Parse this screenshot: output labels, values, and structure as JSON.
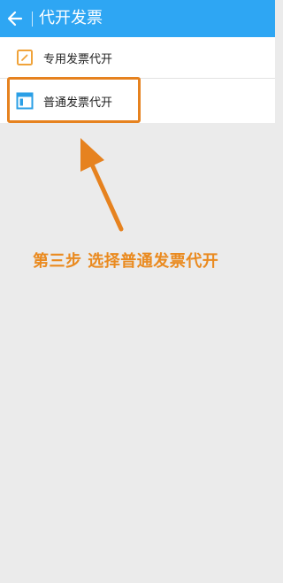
{
  "header": {
    "title": "代开发票",
    "back_icon": "back-arrow-icon"
  },
  "list": {
    "items": [
      {
        "label": "专用发票代开",
        "icon": "edit-document-icon"
      },
      {
        "label": "普通发票代开",
        "icon": "window-form-icon"
      }
    ]
  },
  "annotation": {
    "text": "第三步 选择普通发票代开"
  },
  "colors": {
    "header_bg": "#2ea6f3",
    "highlight": "#e6821f",
    "annotation": "#ea8a1f",
    "page_bg": "#ebebeb"
  }
}
